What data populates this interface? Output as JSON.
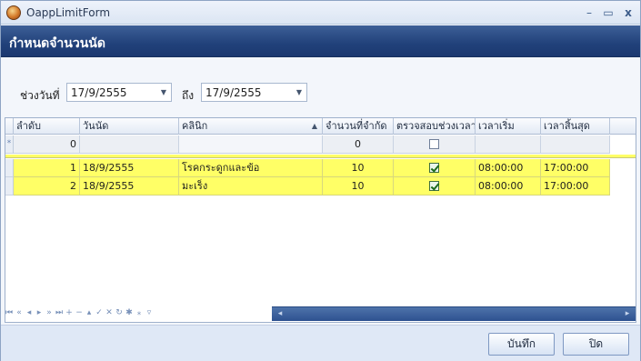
{
  "window": {
    "title": "OappLimitForm",
    "minimize": "–",
    "maximize": "▭",
    "close": "x"
  },
  "header": {
    "title": "กำหนดจำนวนนัด"
  },
  "filter": {
    "from_label": "ช่วงวันที่",
    "from_value": "17/9/2555",
    "to_label": "ถึง",
    "to_value": "17/9/2555"
  },
  "grid": {
    "columns": [
      "ลำดับ",
      "วันนัด",
      "คลินิก",
      "จำนวนที่จำกัด",
      "ตรวจสอบช่วงเวลา",
      "เวลาเริ่ม",
      "เวลาสิ้นสุด"
    ],
    "sorted_column": "คลินิก",
    "new_row": {
      "indicator": "*",
      "seq": "0",
      "limit": "0",
      "check": false
    },
    "rows": [
      {
        "seq": "1",
        "date": "18/9/2555",
        "clinic": "โรคกระดูกและข้อ",
        "limit": "10",
        "check": true,
        "start": "08:00:00",
        "end": "17:00:00"
      },
      {
        "seq": "2",
        "date": "18/9/2555",
        "clinic": "มะเร็ง",
        "limit": "10",
        "check": true,
        "start": "08:00:00",
        "end": "17:00:00"
      }
    ],
    "highlight_color": "#ffff66"
  },
  "navigator": {
    "buttons": [
      "first",
      "prev-page",
      "prev",
      "next",
      "next-page",
      "last",
      "append",
      "remove",
      "edit",
      "end-edit",
      "cancel-edit",
      "refresh",
      "bookmark",
      "goto-bookmark",
      "filter"
    ]
  },
  "footer": {
    "save_label": "บันทึก",
    "close_label": "ปิด"
  }
}
